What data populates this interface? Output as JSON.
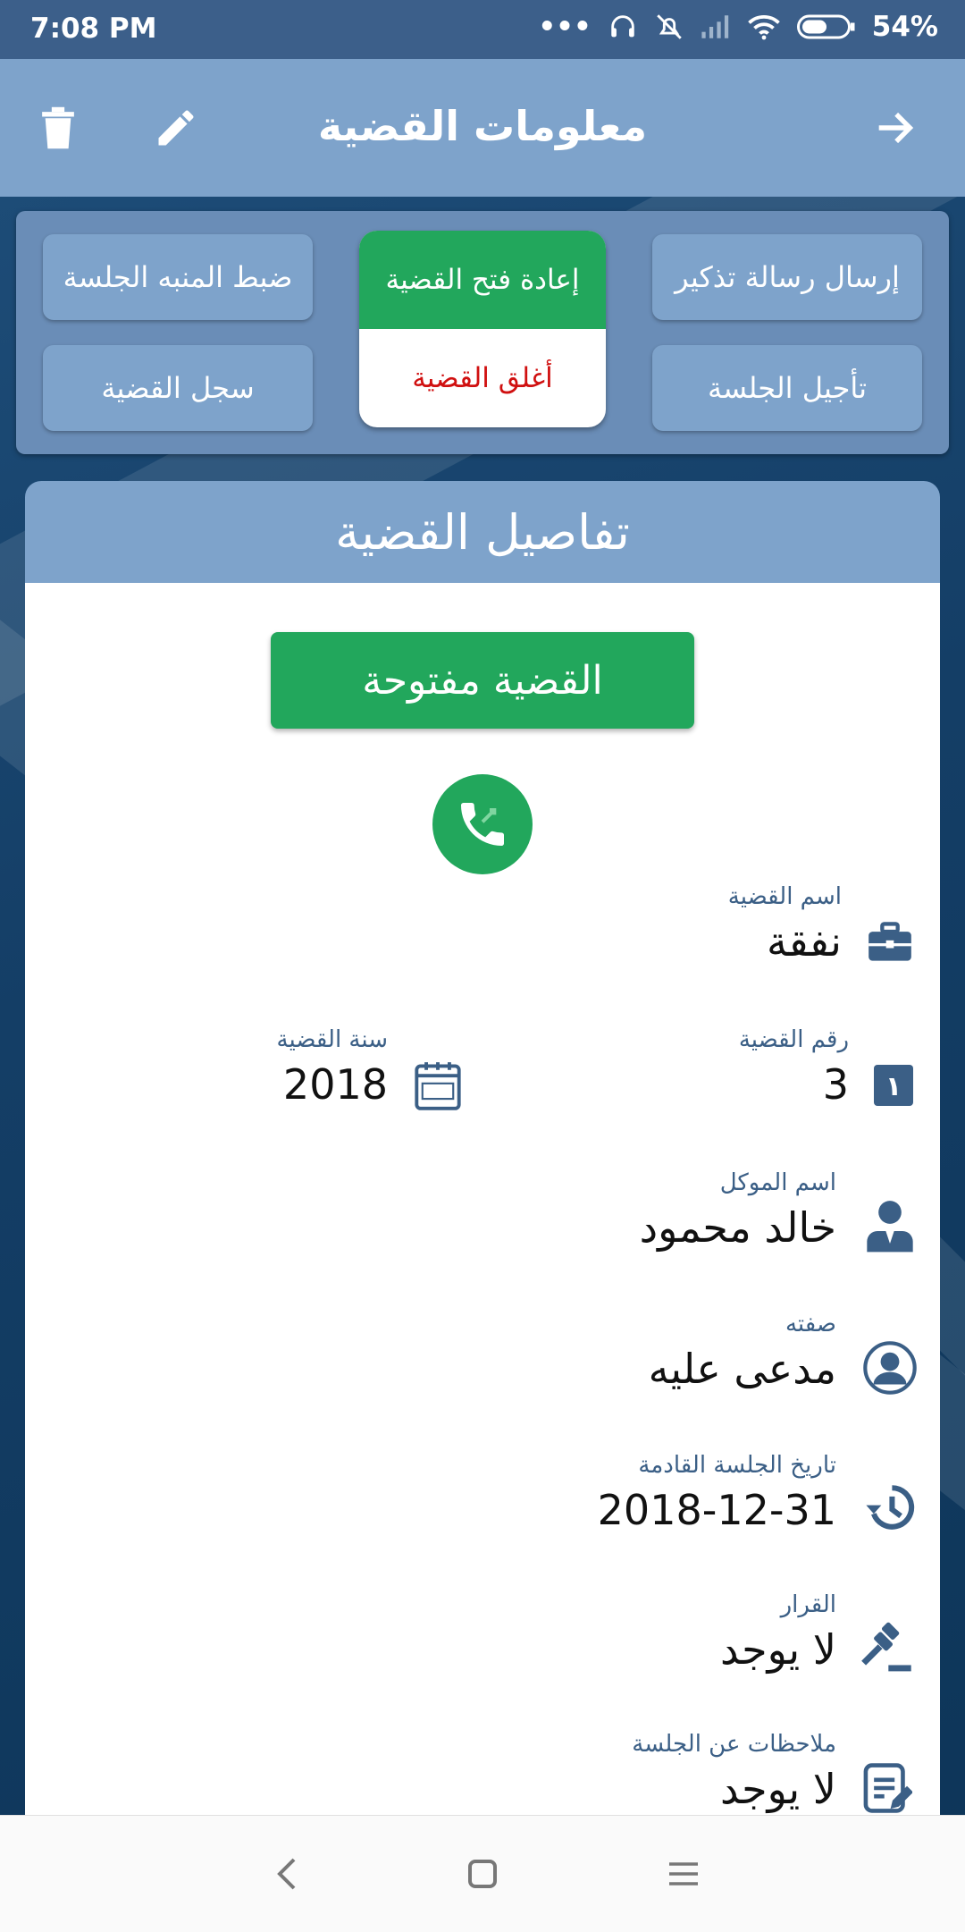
{
  "status_bar": {
    "time": "7:08 PM",
    "battery": "54%"
  },
  "app_bar": {
    "title": "معلومات القضية"
  },
  "actions": {
    "send_reminder": "إرسال رسالة تذكير",
    "reopen_case": "إعادة فتح القضية",
    "close_case": "أغلق القضية",
    "set_alarm": "ضبط المنبه الجلسة",
    "postpone_session": "تأجيل الجلسة",
    "case_log": "سجل القضية"
  },
  "details": {
    "header": "تفاصيل القضية",
    "status": "القضية مفتوحة",
    "case_name": {
      "label": "اسم القضية",
      "value": "نفقة"
    },
    "case_number": {
      "label": "رقم القضية",
      "value": "3"
    },
    "case_year": {
      "label": "سنة القضية",
      "value": "2018"
    },
    "client_name": {
      "label": "اسم الموكل",
      "value": "خالد محمود"
    },
    "client_role": {
      "label": "صفته",
      "value": "مدعى عليه"
    },
    "next_session": {
      "label": "تاريخ الجلسة القادمة",
      "value": "2018-12-31"
    },
    "decision": {
      "label": "القرار",
      "value": "لا يوجد"
    },
    "session_notes": {
      "label": "ملاحظات عن الجلسة",
      "value": "لا يوجد"
    }
  },
  "colors": {
    "primary": "#7ea3cb",
    "green": "#22a75c",
    "red": "#d01010",
    "icon": "#3b5f86"
  }
}
